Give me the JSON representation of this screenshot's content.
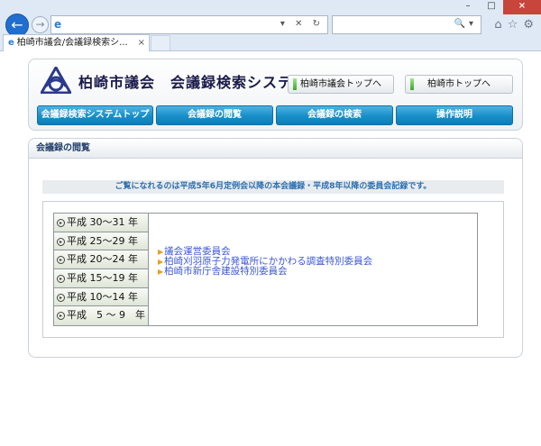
{
  "browser": {
    "tab_title": "柏崎市議会/会議録検索シ...",
    "tab_close": "×",
    "window_controls": {
      "minimize": "–",
      "maximize": "□",
      "close": "×"
    },
    "address_controls": "▾ ✕ ↻",
    "search_controls": "🔍▾",
    "toolbar_icons": [
      "home-icon",
      "star-icon",
      "gear-icon"
    ]
  },
  "header": {
    "site_title": "柏崎市議会　会議録検索システム",
    "links": [
      {
        "label": "柏崎市議会トップへ"
      },
      {
        "label": "柏崎市トップへ"
      }
    ]
  },
  "nav": [
    {
      "label": "会議録検索システムトップ"
    },
    {
      "label": "会議録の閲覧"
    },
    {
      "label": "会議録の検索"
    },
    {
      "label": "操作説明"
    }
  ],
  "main": {
    "section_title": "会議録の閲覧",
    "notice": "ご覧になれるのは平成5年6月定例会以降の本会議録・平成8年以降の委員会記録です。",
    "years": [
      {
        "label": "平成 30～31 年"
      },
      {
        "label": "平成 25～29 年"
      },
      {
        "label": "平成 20～24 年"
      },
      {
        "label": "平成 15～19 年"
      },
      {
        "label": "平成 10～14 年"
      },
      {
        "label": "平成　5 ～ 9　年"
      }
    ],
    "committees": [
      {
        "label": "議会運営委員会"
      },
      {
        "label": "柏崎刈羽原子力発電所にかかわる調査特別委員会"
      },
      {
        "label": "柏崎市新庁舎建設特別委員会"
      }
    ]
  },
  "colors": {
    "nav_blue": "#178ec8",
    "notice_text": "#2b6fb0",
    "link_blue": "#3a55d8",
    "bullet_orange": "#e8a020"
  }
}
